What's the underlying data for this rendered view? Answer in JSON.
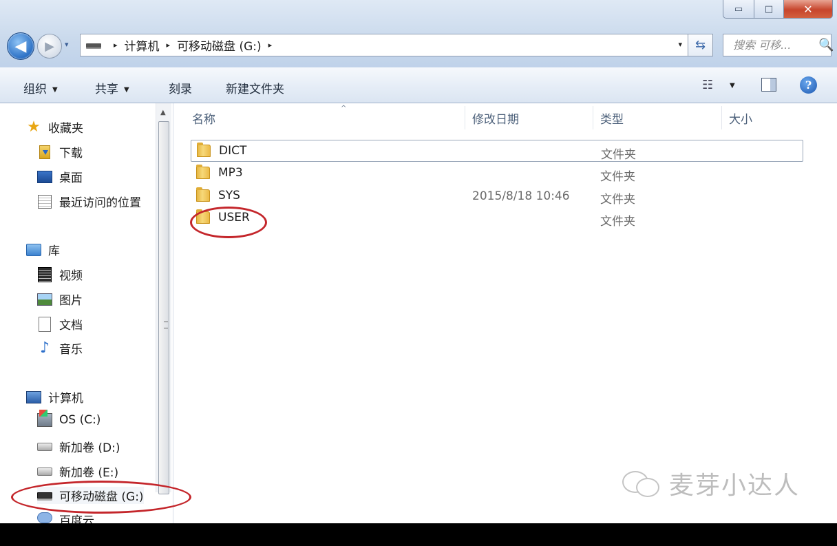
{
  "window": {
    "controls": {
      "minimize": "▭",
      "maximize": "□",
      "close": "✕"
    }
  },
  "navigation": {
    "back_glyph": "◀",
    "forward_glyph": "▶",
    "recent_caret": "▾"
  },
  "address_bar": {
    "drive_icon": "usb-drive-icon",
    "segments": [
      "计算机",
      "可移动磁盘 (G:)"
    ],
    "separator": "▸",
    "dropdown": "▾",
    "refresh": "⇆"
  },
  "search": {
    "placeholder": "搜索 可移...",
    "icon": "🔍"
  },
  "toolbar": {
    "organize": "组织",
    "share": "共享",
    "burn": "刻录",
    "new_folder": "新建文件夹",
    "caret": "▼",
    "views_icon": "☷",
    "help": "?"
  },
  "nav_pane": {
    "favorites": "收藏夹",
    "downloads": "下载",
    "desktop": "桌面",
    "recent": "最近访问的位置",
    "libraries": "库",
    "videos": "视频",
    "pictures": "图片",
    "documents": "文档",
    "music": "音乐",
    "computer": "计算机",
    "drive_c": "OS (C:)",
    "drive_d": "新加卷 (D:)",
    "drive_e": "新加卷 (E:)",
    "drive_g": "可移动磁盘 (G:)",
    "baidu": "百度云",
    "scroll_up": "▲"
  },
  "columns": {
    "name": "名称",
    "modified": "修改日期",
    "type": "类型",
    "size": "大小",
    "sort_indicator": "^"
  },
  "files": [
    {
      "name": "DICT",
      "modified": "",
      "type": "文件夹"
    },
    {
      "name": "MP3",
      "modified": "",
      "type": "文件夹"
    },
    {
      "name": "SYS",
      "modified": "2015/8/18 10:46",
      "type": "文件夹"
    },
    {
      "name": "USER",
      "modified": "",
      "type": "文件夹"
    }
  ],
  "watermark": {
    "text": "麦芽小达人"
  },
  "annotations": {
    "color": "#c4262b"
  }
}
